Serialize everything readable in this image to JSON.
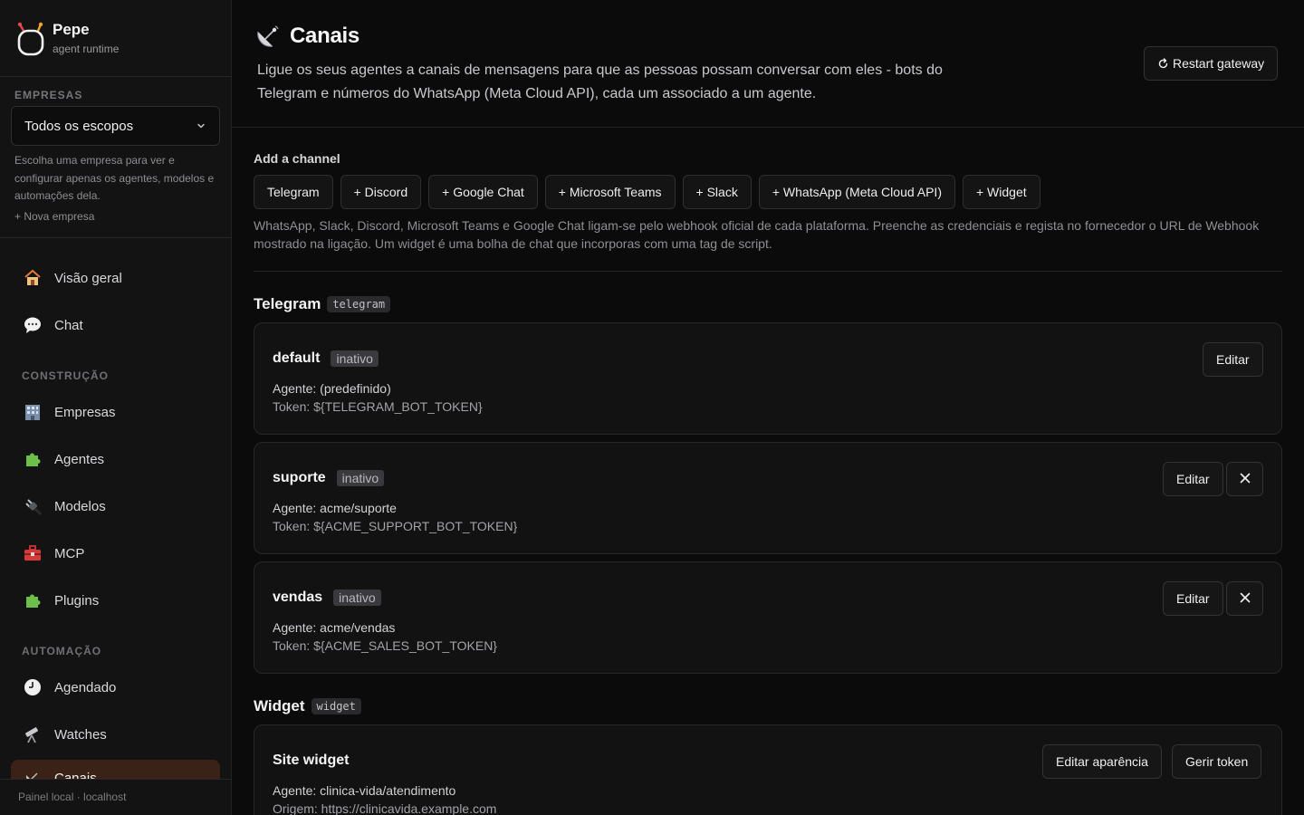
{
  "brand": {
    "name": "Pepe",
    "subtitle": "agent runtime"
  },
  "sidebar": {
    "companies_label": "EMPRESAS",
    "scope_value": "Todos os escopos",
    "scope_help": "Escolha uma empresa para ver e configurar apenas os agentes, modelos e automações dela.",
    "new_company": "+ Nova empresa",
    "nav_main": [
      {
        "label": "Visão geral",
        "icon": "house-icon"
      },
      {
        "label": "Chat",
        "icon": "speech-bubble-icon"
      }
    ],
    "section_build": "CONSTRUÇÃO",
    "nav_build": [
      {
        "label": "Empresas",
        "icon": "office-building-icon"
      },
      {
        "label": "Agentes",
        "icon": "puzzle-piece-icon"
      },
      {
        "label": "Modelos",
        "icon": "electric-plug-icon"
      },
      {
        "label": "MCP",
        "icon": "toolbox-icon"
      },
      {
        "label": "Plugins",
        "icon": "puzzle-piece-icon"
      }
    ],
    "section_auto": "AUTOMAÇÃO",
    "nav_auto": [
      {
        "label": "Agendado",
        "icon": "clock-icon"
      },
      {
        "label": "Watches",
        "icon": "telescope-icon"
      },
      {
        "label": "Canais",
        "icon": "satellite-antenna-icon",
        "active": true
      }
    ],
    "footer": "Painel local · localhost"
  },
  "header": {
    "title": "Canais",
    "title_icon": "satellite-antenna-icon",
    "description": "Ligue os seus agentes a canais de mensagens para que as pessoas possam conversar com eles - bots do Telegram e números do WhatsApp (Meta Cloud API), cada um associado a um agente.",
    "restart_label": "Restart gateway"
  },
  "add_channel": {
    "label": "Add a channel",
    "buttons": [
      "Telegram",
      "+ Discord",
      "+ Google Chat",
      "+ Microsoft Teams",
      "+ Slack",
      "+ WhatsApp (Meta Cloud API)",
      "+ Widget"
    ],
    "help": "WhatsApp, Slack, Discord, Microsoft Teams e Google Chat ligam-se pelo webhook oficial de cada plataforma. Preenche as credenciais e regista no fornecedor o URL de Webhook mostrado na ligação. Um widget é uma bolha de chat que incorporas com uma tag de script."
  },
  "telegram": {
    "title": "Telegram",
    "tag": "telegram",
    "edit_label": "Editar",
    "cards": [
      {
        "name": "default",
        "status": "inativo",
        "agent": "Agente: (predefinido)",
        "token": "Token: ${TELEGRAM_BOT_TOKEN}"
      },
      {
        "name": "suporte",
        "status": "inativo",
        "agent": "Agente: acme/suporte",
        "token": "Token: ${ACME_SUPPORT_BOT_TOKEN}"
      },
      {
        "name": "vendas",
        "status": "inativo",
        "agent": "Agente: acme/vendas",
        "token": "Token: ${ACME_SALES_BOT_TOKEN}"
      }
    ]
  },
  "widget": {
    "title": "Widget",
    "tag": "widget",
    "card": {
      "name": "Site widget",
      "agent": "Agente: clinica-vida/atendimento",
      "origin": "Origem: https://clinicavida.example.com",
      "edit_appearance": "Editar aparência",
      "manage_token": "Gerir token"
    }
  }
}
